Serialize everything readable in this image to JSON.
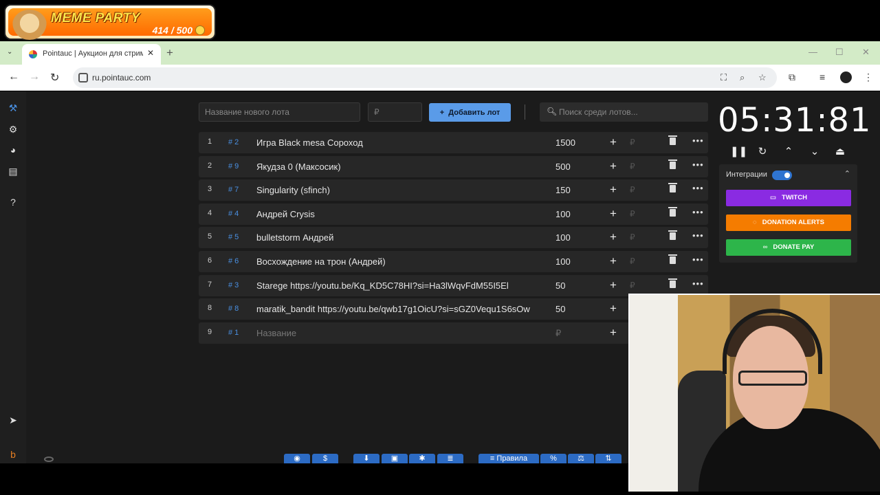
{
  "overlay": {
    "title": "MEME PARTY",
    "count": "414 / 500"
  },
  "browser": {
    "tab_title": "Pointauc | Аукцион для стримеров",
    "url": "ru.pointauc.com"
  },
  "form": {
    "lot_name_placeholder": "Название нового лота",
    "amount_placeholder": "₽",
    "add_button": "Добавить лот",
    "search_placeholder": "Поиск среди лотов..."
  },
  "lots": [
    {
      "idx": "1",
      "num": "# 2",
      "name": "Игра Black mesa Сороход",
      "amount": "1500"
    },
    {
      "idx": "2",
      "num": "# 9",
      "name": "Якудза 0 (Максосик)",
      "amount": "500"
    },
    {
      "idx": "3",
      "num": "# 7",
      "name": "Singularity (sfinch)",
      "amount": "150"
    },
    {
      "idx": "4",
      "num": "# 4",
      "name": "Андрей Crysis",
      "amount": "100"
    },
    {
      "idx": "5",
      "num": "# 5",
      "name": "bulletstorm Андрей",
      "amount": "100"
    },
    {
      "idx": "6",
      "num": "# 6",
      "name": "Восхождение на трон (Андрей)",
      "amount": "100"
    },
    {
      "idx": "7",
      "num": "# 3",
      "name": "Starege https://youtu.be/Kq_KD5C78HI?si=Ha3lWqvFdM55I5El",
      "amount": "50"
    },
    {
      "idx": "8",
      "num": "# 8",
      "name": "maratik_bandit https://youtu.be/qwb17g1OicU?si=sGZ0Vequ1S6sOw",
      "amount": "50"
    },
    {
      "idx": "9",
      "num": "# 1",
      "name": "Название",
      "amount": "₽"
    }
  ],
  "currency_symbol": "₽",
  "timer": {
    "value": "05:31:81"
  },
  "integrations": {
    "label": "Интеграции",
    "twitch": "TWITCH",
    "donation_alerts": "DONATION ALERTS",
    "donate_pay": "DONATE PAY"
  },
  "bottom_toolbar": {
    "rules_label": "Правила",
    "percent": "%",
    "dollar": "$"
  },
  "colors": {
    "accent": "#5a9be8",
    "twitch": "#8a2be2",
    "donation_alerts": "#f57c00",
    "donate_pay": "#2db54a",
    "app_bg": "#1b1b1b"
  }
}
